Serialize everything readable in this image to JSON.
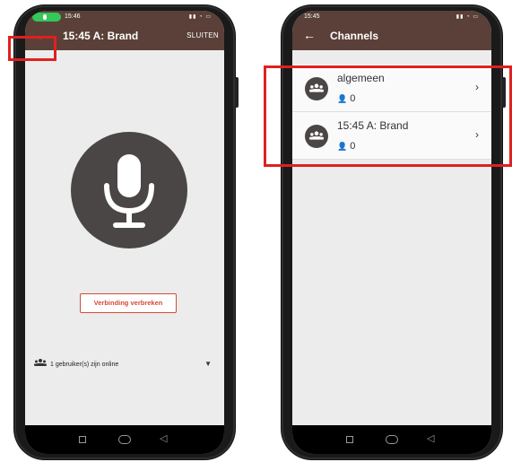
{
  "left": {
    "status": {
      "time": "15:46"
    },
    "appbar": {
      "title": "15:45 A: Brand",
      "action": "SLUITEN"
    },
    "disconnect_label": "Verbinding verbreken",
    "online_label": "1 gebruiker(s) zijn online"
  },
  "right": {
    "status": {
      "time": "15:45"
    },
    "appbar": {
      "title": "Channels"
    },
    "channels": [
      {
        "name": "algemeen",
        "count": "0"
      },
      {
        "name": "15:45 A: Brand",
        "count": "0"
      }
    ]
  },
  "colors": {
    "appbar": "#5a4038",
    "accent_red": "#e02020",
    "mic_bg": "#4a4645"
  }
}
